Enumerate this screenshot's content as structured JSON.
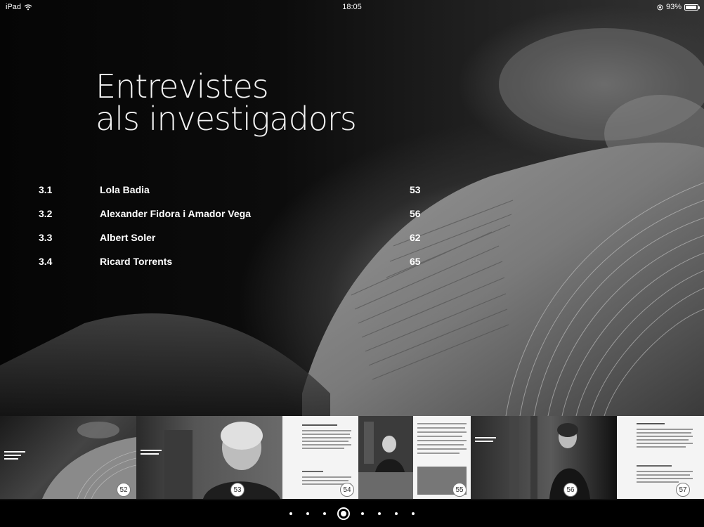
{
  "status": {
    "device": "iPad",
    "time": "18:05",
    "battery": "93%",
    "battery_level": 0.93
  },
  "title": {
    "line1": "Entrevistes",
    "line2": "als investigadors"
  },
  "toc": [
    {
      "number": "3.1",
      "name": "Lola Badia",
      "page": "53"
    },
    {
      "number": "3.2",
      "name": "Alexander Fidora i Amador Vega",
      "page": "56"
    },
    {
      "number": "3.3",
      "name": "Albert Soler",
      "page": "62"
    },
    {
      "number": "3.4",
      "name": "Ricard Torrents",
      "page": "65"
    }
  ],
  "thumbnails": [
    {
      "page": "52"
    },
    {
      "page": "53"
    },
    {
      "page": "54"
    },
    {
      "page": "55"
    },
    {
      "page": "56"
    },
    {
      "page": "57"
    }
  ],
  "pager": {
    "count": 8,
    "active": 3
  },
  "icons": {
    "wifi": "wifi-icon",
    "location": "location-icon",
    "battery": "battery-icon"
  }
}
